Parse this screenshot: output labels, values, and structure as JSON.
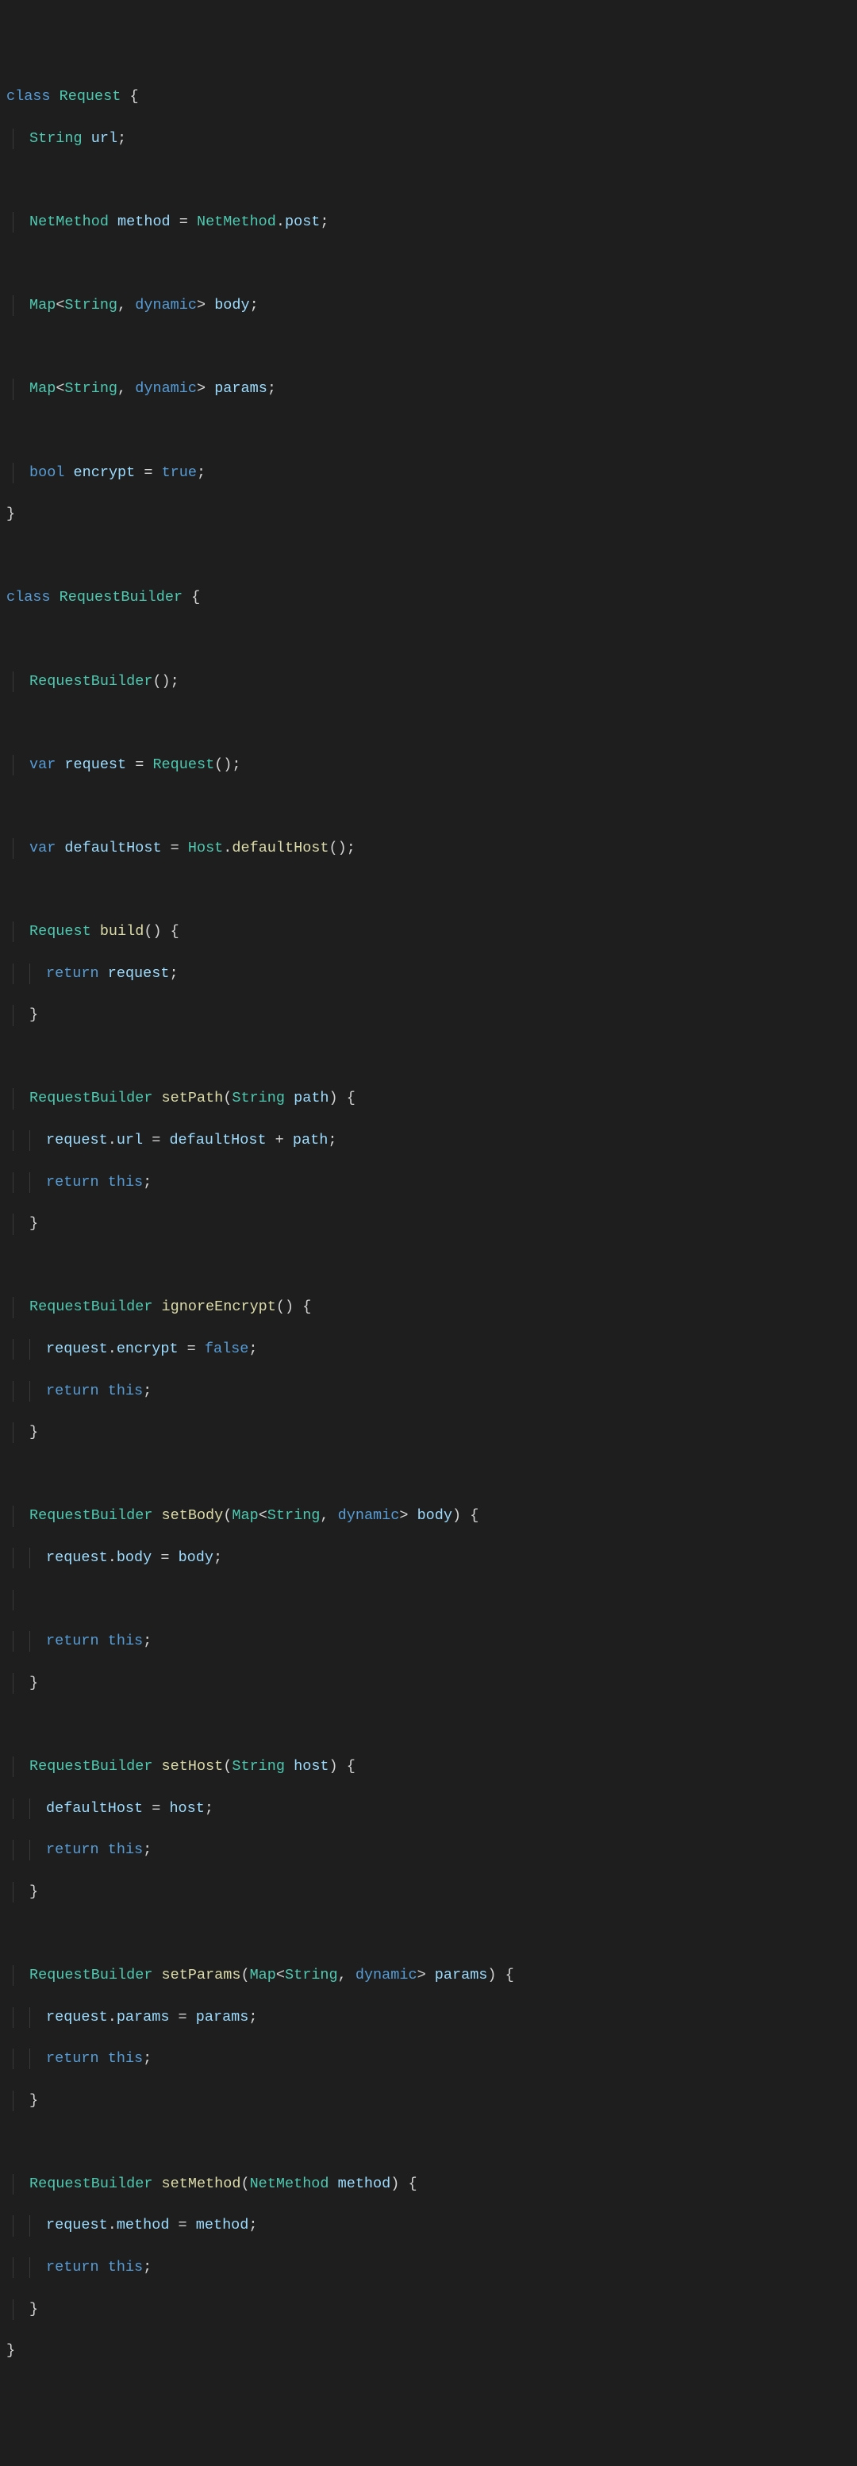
{
  "tokens": {
    "kw_class": "class",
    "kw_return": "return",
    "kw_var": "var",
    "kw_bool": "bool",
    "kw_dynamic": "dynamic",
    "kw_this": "this",
    "lit_true": "true",
    "lit_false": "false",
    "type_Request": "Request",
    "type_String": "String",
    "type_NetMethod": "NetMethod",
    "type_Map": "Map",
    "type_RequestBuilder": "RequestBuilder",
    "type_Host": "Host",
    "field_url": "url",
    "field_method": "method",
    "field_post": "post",
    "field_body": "body",
    "field_params": "params",
    "field_encrypt": "encrypt",
    "field_request": "request",
    "field_defaultHost": "defaultHost",
    "field_path": "path",
    "field_host": "host",
    "fn_build": "build",
    "fn_setPath": "setPath",
    "fn_ignoreEncrypt": "ignoreEncrypt",
    "fn_setBody": "setBody",
    "fn_setHost": "setHost",
    "fn_setParams": "setParams",
    "fn_setMethod": "setMethod",
    "fn_defaultHost": "defaultHost",
    "p_eq": " = ",
    "p_plus": " + ",
    "p_semi": ";",
    "p_lt": "<",
    "p_gt": ">",
    "p_comma": ", ",
    "p_dot": ".",
    "p_lparen": "(",
    "p_rparen": ")",
    "p_lbrace": "{",
    "p_rbrace": "}",
    "p_sp": " "
  }
}
